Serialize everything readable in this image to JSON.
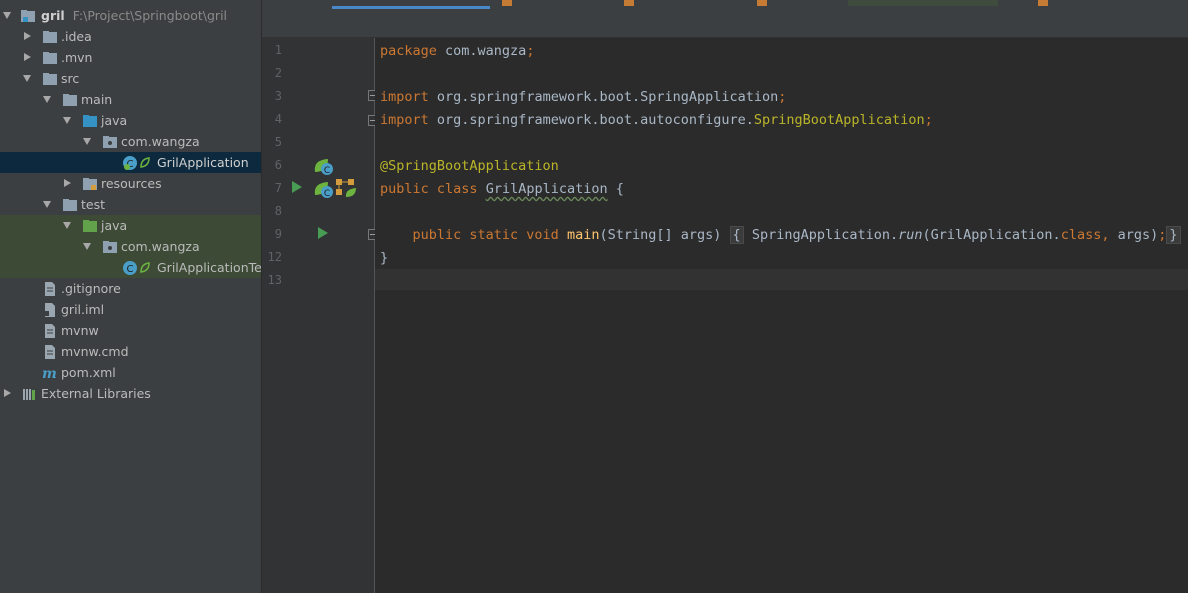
{
  "project": {
    "root_name": "gril",
    "root_path": "F:\\Project\\Springboot\\gril",
    "items": [
      {
        "label": ".idea"
      },
      {
        "label": ".mvn"
      },
      {
        "label": "src"
      },
      {
        "label": "main"
      },
      {
        "label": "java"
      },
      {
        "label": "com.wangza"
      },
      {
        "label": "GrilApplication"
      },
      {
        "label": "resources"
      },
      {
        "label": "test"
      },
      {
        "label": "java"
      },
      {
        "label": "com.wangza"
      },
      {
        "label": "GrilApplicationTes"
      },
      {
        "label": ".gitignore"
      },
      {
        "label": "gril.iml"
      },
      {
        "label": "mvnw"
      },
      {
        "label": "mvnw.cmd"
      },
      {
        "label": "pom.xml"
      },
      {
        "label": "External Libraries"
      }
    ]
  },
  "gutter": {
    "line_numbers": [
      "1",
      "2",
      "3",
      "4",
      "5",
      "6",
      "7",
      "8",
      "9",
      "12",
      "13"
    ]
  },
  "code": {
    "l1_kw": "package",
    "l1_rest": " com.wangza",
    "l1_semi": ";",
    "l3_kw": "import",
    "l3_rest": " org.springframework.boot.SpringApplication",
    "l3_semi": ";",
    "l4_kw": "import",
    "l4_rest": " org.springframework.boot.autoconfigure.",
    "l4_cls": "SpringBootApplication",
    "l4_semi": ";",
    "l6_ann": "@SpringBootApplication",
    "l7_kw": "public class",
    "l7_name": "GrilApplication",
    "l7_rest": " {",
    "l9_indent": "    ",
    "l9_kw": "public static void",
    "l9_fn": "main",
    "l9_params": "(String[] args)",
    "l9_open": "{",
    "l9_body1": " SpringApplication.",
    "l9_run": "run",
    "l9_body2": "(GrilApplication.",
    "l9_class": "class",
    "l9_comma": ",",
    "l9_body3": " args)",
    "l9_semi": ";",
    "l9_close": "}",
    "l12": "}"
  },
  "colors": {
    "keyword": "#cc7832",
    "annotation": "#bbb529",
    "function": "#ffc66d",
    "text": "#a9b7c6",
    "selection": "#0d293e"
  }
}
